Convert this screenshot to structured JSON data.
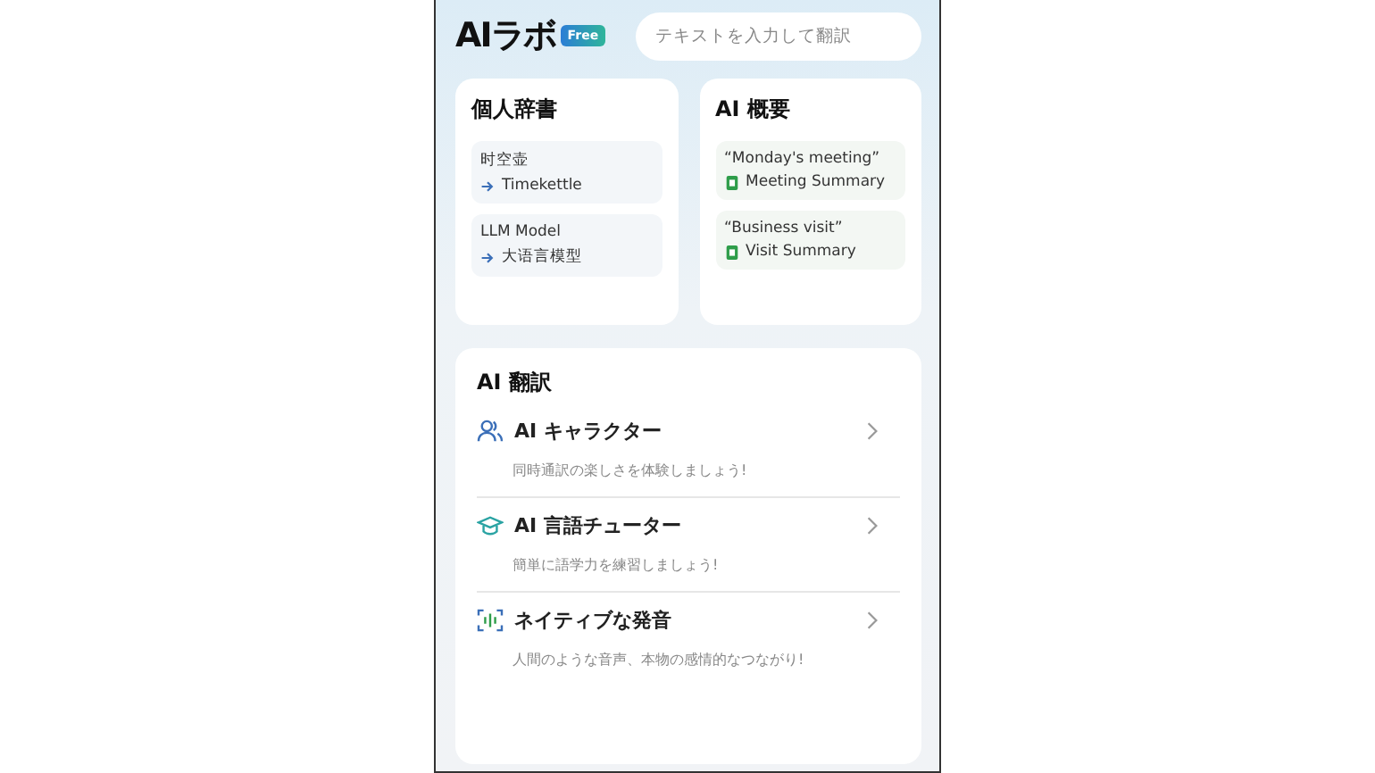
{
  "header": {
    "title": "AIラボ",
    "badge": "Free",
    "search": {
      "placeholder": "テキストを入力して翻訳"
    }
  },
  "dictionary": {
    "title": "個人辞書",
    "entries": [
      {
        "source": "时空壶",
        "target": "Timekettle"
      },
      {
        "source": "LLM Model",
        "target": "大语言模型"
      }
    ]
  },
  "summary": {
    "title": "AI 概要",
    "entries": [
      {
        "quote": "“Monday's meeting”",
        "doc": "Meeting Summary"
      },
      {
        "quote": "“Business visit”",
        "doc": "Visit Summary"
      }
    ]
  },
  "translation": {
    "title": "AI 翻訳",
    "items": [
      {
        "kind": "people",
        "title": "AI キャラクター",
        "subtitle": "同時通訳の楽しさを体験しましょう!"
      },
      {
        "kind": "cap",
        "title": "AI 言語チューター",
        "subtitle": "簡単に語学力を練習しましょう!"
      },
      {
        "kind": "voice",
        "title": "ネイティブな発音",
        "subtitle": "人間のような音声、本物の感情的なつながり!"
      }
    ]
  }
}
